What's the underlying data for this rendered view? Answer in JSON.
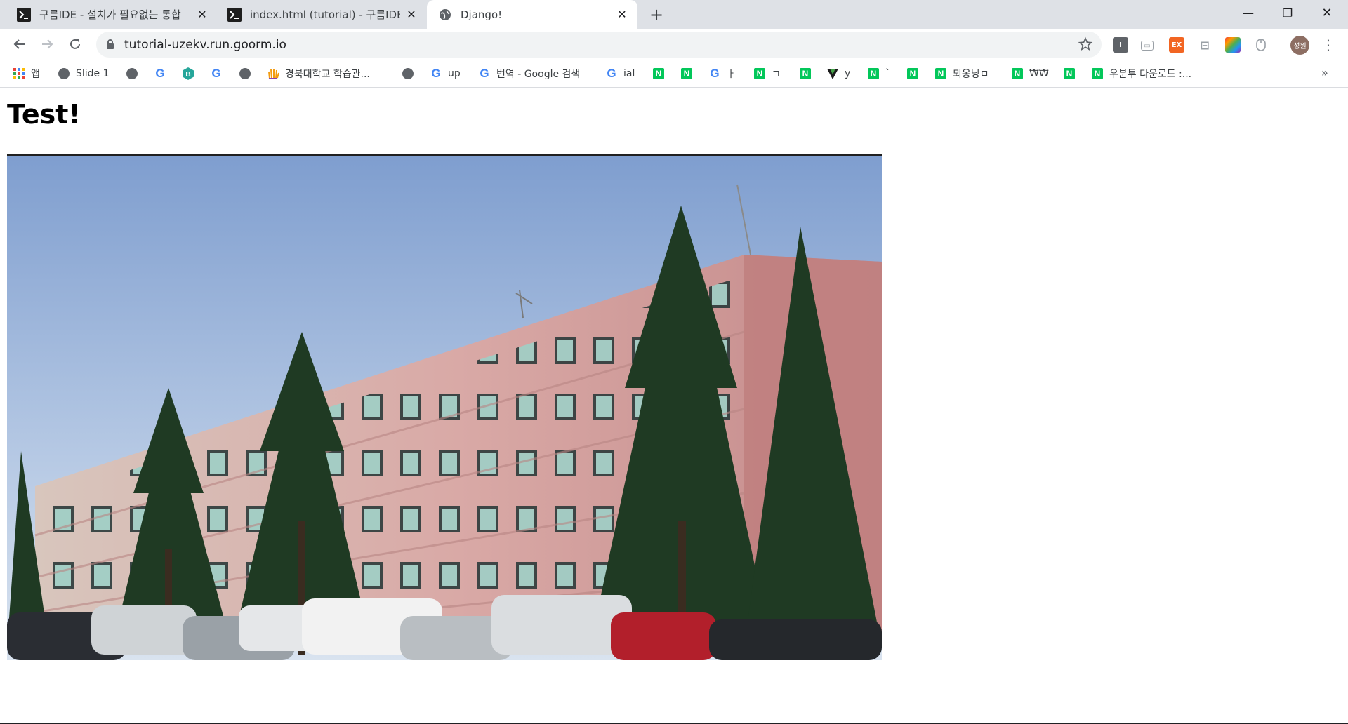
{
  "tabs": [
    {
      "title": "구름IDE - 설치가 필요없는 통합",
      "favicon": "terminal-icon",
      "active": false
    },
    {
      "title": "index.html (tutorial) - 구름IDE",
      "favicon": "terminal-icon",
      "active": false
    },
    {
      "title": "Django!",
      "favicon": "globe-icon",
      "active": true
    }
  ],
  "omnibox": {
    "url": "tutorial-uzekv.run.goorm.io",
    "security_icon": "lock-icon"
  },
  "extensions": [
    {
      "name": "extension-i-icon",
      "color": "#5f6368",
      "label": "I"
    },
    {
      "name": "extension-cast-icon",
      "color": "#9aa0a6",
      "label": "▭"
    },
    {
      "name": "extension-ex-icon",
      "color": "#f26522",
      "label": "EX"
    },
    {
      "name": "extension-layout-icon",
      "color": "#9aa0a6",
      "label": "⊟"
    },
    {
      "name": "extension-colorgrid-icon",
      "color": "#e91e63",
      "label": ""
    },
    {
      "name": "extension-mouse-icon",
      "color": "#9aa0a6",
      "label": ""
    }
  ],
  "profile": {
    "initials": "성원"
  },
  "bookmarks": [
    {
      "label": "앱",
      "icon": "apps-grid-icon"
    },
    {
      "label": "Slide 1",
      "icon": "globe-icon"
    },
    {
      "label": "",
      "icon": "globe-icon"
    },
    {
      "label": "",
      "icon": "google-icon"
    },
    {
      "label": "",
      "icon": "b-badge-icon"
    },
    {
      "label": "",
      "icon": "google-icon"
    },
    {
      "label": "",
      "icon": "globe-icon"
    },
    {
      "label": "경북대학교 학습관...",
      "icon": "knu-hand-icon"
    },
    {
      "label": "",
      "icon": "globe-icon"
    },
    {
      "label": "up",
      "icon": "google-icon"
    },
    {
      "label": "번역 - Google 검색",
      "icon": "google-icon"
    },
    {
      "label": "ial",
      "icon": "google-icon"
    },
    {
      "label": "",
      "icon": "naver-icon"
    },
    {
      "label": "",
      "icon": "naver-icon"
    },
    {
      "label": "ㅏ",
      "icon": "google-icon"
    },
    {
      "label": "ㄱ",
      "icon": "naver-icon"
    },
    {
      "label": "",
      "icon": "naver-icon"
    },
    {
      "label": "y",
      "icon": "vuetify-icon"
    },
    {
      "label": "`",
      "icon": "naver-icon"
    },
    {
      "label": "",
      "icon": "naver-icon"
    },
    {
      "label": "뫼옹닝ㅁ",
      "icon": "naver-icon"
    },
    {
      "label": "₩₩",
      "icon": "naver-icon"
    },
    {
      "label": "",
      "icon": "naver-icon"
    },
    {
      "label": "우분투 다운로드 :...",
      "icon": "naver-icon"
    }
  ],
  "bookmarks_more": "»",
  "page": {
    "heading": "Test!",
    "image_alt": "Pink tiled multi-story building with pine trees and parked cars"
  }
}
